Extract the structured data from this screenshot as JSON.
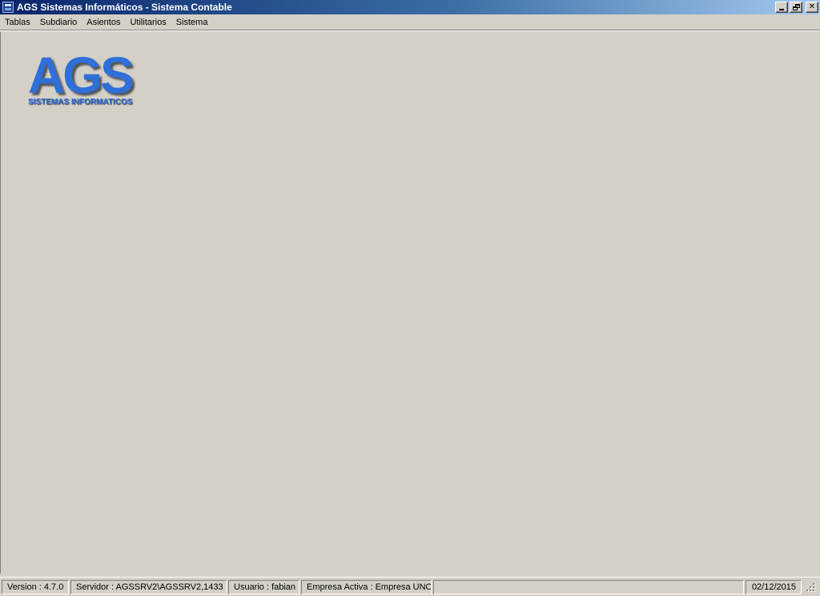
{
  "window": {
    "title": "AGS Sistemas Informáticos - Sistema Contable",
    "icon": "app-icon",
    "controls": {
      "minimize": "minimize-icon",
      "restore": "restore-icon",
      "close": "✕"
    }
  },
  "menu": {
    "items": [
      {
        "label": "Tablas"
      },
      {
        "label": "Subdiario"
      },
      {
        "label": "Asientos"
      },
      {
        "label": "Utilitarios"
      },
      {
        "label": "Sistema"
      }
    ]
  },
  "logo": {
    "main": "AGS",
    "sub": "SISTEMAS INFORMATICOS",
    "color": "#2e6fd8"
  },
  "status": {
    "version": "Version : 4.7.0",
    "server": "Servidor : AGSSRV2\\AGSSRV2,1433",
    "user": "Usuario : fabian",
    "company": "Empresa Activa : Empresa UNO",
    "blank": "",
    "date": "02/12/2015"
  }
}
